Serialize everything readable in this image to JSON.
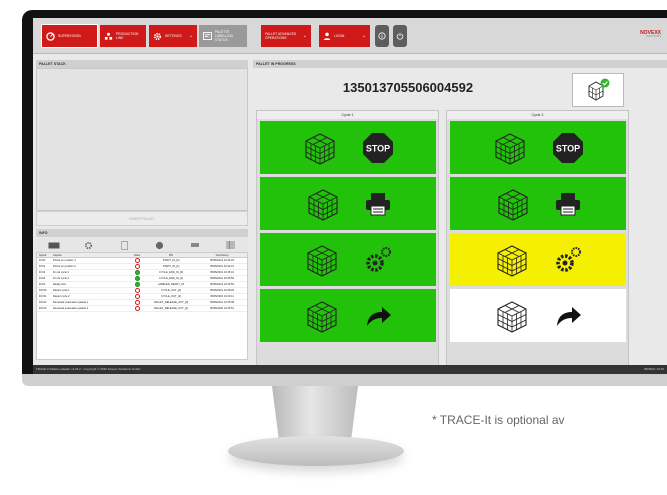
{
  "toolbar": {
    "buttons": [
      {
        "label": "SUPERVISION"
      },
      {
        "label": "PRODUCTION LINE"
      },
      {
        "label": "SETTINGS"
      },
      {
        "label": "PALETTE LABELLING STATUS"
      },
      {
        "label": "PALLET ADVANCED OPERATIONS"
      },
      {
        "label": "LOGIN"
      }
    ],
    "logo": "NOVEXX",
    "logo_sub": "SOLUTIONS"
  },
  "pallet_stack": {
    "title": "PALLET STACK",
    "insert_label": "INSERT PALLET"
  },
  "info": {
    "title": "INFO",
    "columns": [
      "Signal",
      "Caption",
      "Value",
      "PID",
      "TimeStamp"
    ],
    "rows": [
      {
        "signal": "DI:00",
        "caption": "Pointe en position 1",
        "ok": false,
        "pid": "START_IN_[0]",
        "time": "05/05/2021 10:44:04"
      },
      {
        "signal": "DI:01",
        "caption": "Pointe en position 2",
        "ok": false,
        "pid": "START_IN_[1]",
        "time": "05/05/2021 10:44:10"
      },
      {
        "signal": "DI:02",
        "caption": "Fin de cycle 1",
        "ok": true,
        "pid": "CYCLE_END_IN_[0]",
        "time": "05/05/2021 10:45:31"
      },
      {
        "signal": "DI:03",
        "caption": "Fin de cycle 2",
        "ok": true,
        "pid": "CYCLE_END_IN_[1]",
        "time": "05/05/2021 10:45:59"
      },
      {
        "signal": "DI:04",
        "caption": "Ready Axis",
        "ok": true,
        "pid": "LABELER_READY_IN",
        "time": "05/05/2021 10:30:59"
      },
      {
        "signal": "DO:00",
        "caption": "Départ cycle 1",
        "ok": false,
        "pid": "CYCLE_OUT_[0]",
        "time": "05/05/2021 10:45:45"
      },
      {
        "signal": "DO:01",
        "caption": "Départ cycle 2",
        "ok": false,
        "pid": "CYCLE_OUT_[1]",
        "time": "05/05/2021 10:44:11"
      },
      {
        "signal": "DO:02",
        "caption": "Demande évacuation palette 1",
        "ok": false,
        "pid": "PALLET_RELEASE_OUT_[0]",
        "time": "05/05/2021 10:45:08"
      },
      {
        "signal": "DO:03",
        "caption": "Demande évacuation palette 2",
        "ok": false,
        "pid": "PALLET_RELEASE_OUT_[1]",
        "time": "05/05/2020 13:45:51"
      }
    ]
  },
  "progress": {
    "title": "PALLET IN PROGRESS",
    "pallet_number": "135013705506004592",
    "cycle1": {
      "title": "Cycle 1",
      "steps": [
        "#22c10a",
        "#22c10a",
        "#22c10a",
        "#22c10a"
      ]
    },
    "cycle2": {
      "title": "Cycle 2",
      "steps": [
        "#22c10a",
        "#22c10a",
        "#f5f000",
        "#ffffff"
      ]
    },
    "stop_label": "STOP"
  },
  "status_bar": {
    "left": "TRACE-It Pallets Labeller v1.03.2 - Copyright © 2020 Novexx Solutions GmbH",
    "right": "05/05/21 10:46"
  },
  "footnote": "* TRACE-It is optional av"
}
